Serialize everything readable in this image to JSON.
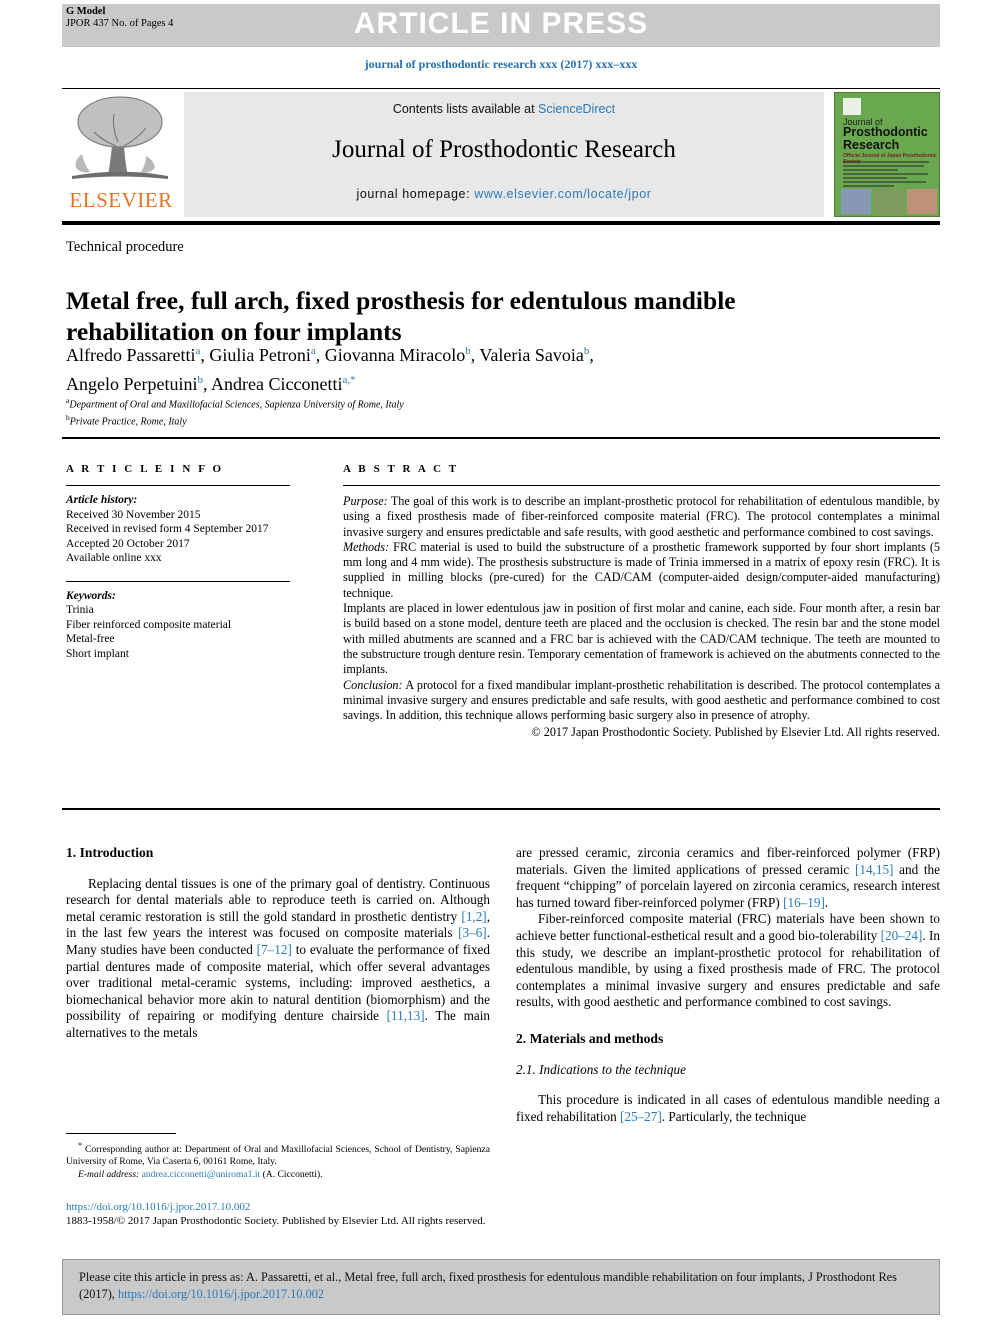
{
  "banner": {
    "gmodel_line1": "G Model",
    "gmodel_line2": "JPOR 437 No. of Pages 4",
    "article_in_press": "ARTICLE IN PRESS",
    "running_head": "journal of prosthodontic research xxx (2017) xxx–xxx"
  },
  "masthead": {
    "contents_prefix": "Contents lists available at ",
    "sciencedirect": "ScienceDirect",
    "journal_name": "Journal of Prosthodontic Research",
    "homepage_label": "journal homepage: ",
    "homepage_url": "www.elsevier.com/locate/jpor",
    "publisher_wordmark": "ELSEVIER",
    "cover": {
      "line1": "Journal of",
      "line2": "Prosthodontic Research",
      "line3": "Official Journal of Japan Prosthodontic Society"
    }
  },
  "article": {
    "category": "Technical procedure",
    "title": "Metal free, full arch, fixed prosthesis for edentulous mandible rehabilitation on four implants",
    "authors": [
      {
        "name": "Alfredo Passaretti",
        "sup": "a",
        "sep": ", "
      },
      {
        "name": "Giulia Petroni",
        "sup": "a",
        "sep": ", "
      },
      {
        "name": "Giovanna Miracolo",
        "sup": "b",
        "sep": ", "
      },
      {
        "name": "Valeria Savoia",
        "sup": "b",
        "sep": ","
      },
      {
        "name": "Angelo Perpetuini",
        "sup": "b",
        "sep": ", "
      },
      {
        "name": "Andrea Cicconetti",
        "sup": "a,*",
        "sep": ""
      }
    ],
    "affiliations": [
      {
        "marker": "a",
        "text": "Department of Oral and Maxillofacial Sciences, Sapienza University of Rome, Italy"
      },
      {
        "marker": "b",
        "text": "Private Practice, Rome, Italy"
      }
    ]
  },
  "article_info": {
    "heading": "A R T I C L E  I N F O",
    "history_label": "Article history:",
    "history": [
      "Received 30 November 2015",
      "Received in revised form 4 September 2017",
      "Accepted 20 October 2017",
      "Available online xxx"
    ],
    "keywords_label": "Keywords:",
    "keywords": [
      "Trinia",
      "Fiber reinforced composite material",
      "Metal-free",
      "Short implant"
    ]
  },
  "abstract": {
    "heading": "A B S T R A C T",
    "purpose_label": "Purpose:",
    "purpose": " The goal of this work is to describe an implant-prosthetic protocol for rehabilitation of edentulous mandible, by using a fixed prosthesis made of fiber-reinforced composite material (FRC). The protocol contemplates a minimal invasive surgery and ensures predictable and safe results, with good aesthetic and performance combined to cost savings.",
    "methods_label": "Methods:",
    "methods": " FRC material is used to build the substructure of a prosthetic framework supported by four short implants (5 mm long and 4 mm wide). The prosthesis substructure is made of Trinia immersed in a matrix of epoxy resin (FRC). It is supplied in milling blocks (pre-cured) for the CAD/CAM (computer-aided design/computer-aided manufacturing) technique.",
    "methods_cont": "Implants are placed in lower edentulous jaw in position of first molar and canine, each side. Four month after, a resin bar is build based on a stone model, denture teeth are placed and the occlusion is checked. The resin bar and the stone model with milled abutments are scanned and a FRC bar is achieved with the CAD/CAM technique. The teeth are mounted to the substructure trough denture resin. Temporary cementation of framework is achieved on the abutments connected to the implants.",
    "conclusion_label": "Conclusion:",
    "conclusion": " A protocol for a fixed mandibular implant-prosthetic rehabilitation is described. The protocol contemplates a minimal invasive surgery and ensures predictable and safe results, with good aesthetic and performance combined to cost savings. In addition, this technique allows performing basic surgery also in presence of atrophy.",
    "copyright": "© 2017 Japan Prosthodontic Society. Published by Elsevier Ltd. All rights reserved."
  },
  "body": {
    "intro_heading": "1. Introduction",
    "intro_p1_a": "Replacing dental tissues is one of the primary goal of dentistry. Continuous research for dental materials able to reproduce teeth is carried on. Although metal ceramic restoration is still the gold standard in prosthetic dentistry ",
    "intro_ref1": "[1,2]",
    "intro_p1_b": ", in the last few years the interest was focused on composite materials ",
    "intro_ref2": "[3–6]",
    "intro_p1_c": ". Many studies have been conducted ",
    "intro_ref3": "[7–12]",
    "intro_p1_d": " to evaluate the performance of fixed partial dentures made of composite material, which offer several advantages over traditional metal-ceramic systems, including: improved aesthetics, a biomechanical behavior more akin to natural dentition (biomorphism) and the possibility of repairing or modifying denture chairside ",
    "intro_ref4": "[11,13]",
    "intro_p1_e": ". The main alternatives to the metals",
    "right_p1_a": "are pressed ceramic, zirconia ceramics and fiber-reinforced polymer (FRP) materials. Given the limited applications of pressed ceramic ",
    "right_ref1": "[14,15]",
    "right_p1_b": " and the frequent “chipping” of porcelain layered on zirconia ceramics, research interest has turned toward fiber-reinforced polymer (FRP) ",
    "right_ref2": "[16–19]",
    "right_p1_c": ".",
    "right_p2_a": "Fiber-reinforced composite material (FRC) materials have been shown to achieve better functional-esthetical result and a good bio-tolerability ",
    "right_ref3": "[20–24]",
    "right_p2_b": ". In this study, we describe an implant-prosthetic protocol for rehabilitation of edentulous mandible, by using a fixed prosthesis made of FRC. The protocol contemplates a minimal invasive surgery and ensures predictable and safe results, with good aesthetic and performance combined to cost savings.",
    "materials_heading": "2. Materials and methods",
    "indications_heading": "2.1. Indications to the technique",
    "indications_p_a": "This procedure is indicated in all cases of edentulous mandible needing a fixed rehabilitation ",
    "indications_ref": "[25–27]",
    "indications_p_b": ". Particularly, the technique"
  },
  "footnote": {
    "marker": "*",
    "corresponding": " Corresponding author at: Department of Oral and Maxillofacial Sciences, School of Dentistry, Sapienza University of Rome, Via Caserta 6, 00161 Rome, Italy.",
    "email_label": "E-mail address:",
    "email": "andrea.cicconetti@uniroma1.it",
    "email_suffix": " (A. Cicconetti)."
  },
  "footer": {
    "doi": "https://doi.org/10.1016/j.jpor.2017.10.002",
    "issn_line": "1883-1958/© 2017 Japan Prosthodontic Society. Published by Elsevier Ltd. All rights reserved."
  },
  "cite_box": {
    "text_a": "Please cite this article in press as: A. Passaretti, et al., Metal free, full arch, fixed prosthesis for edentulous mandible rehabilitation on four implants, J Prosthodont Res (2017), ",
    "doi": "https://doi.org/10.1016/j.jpor.2017.10.002"
  },
  "colors": {
    "link": "#2a7ab9",
    "banner_gray": "#c9c9c9",
    "masthead_gray": "#e8e8e8",
    "elsevier_orange": "#e87422",
    "cover_green": "#6aa84f"
  }
}
